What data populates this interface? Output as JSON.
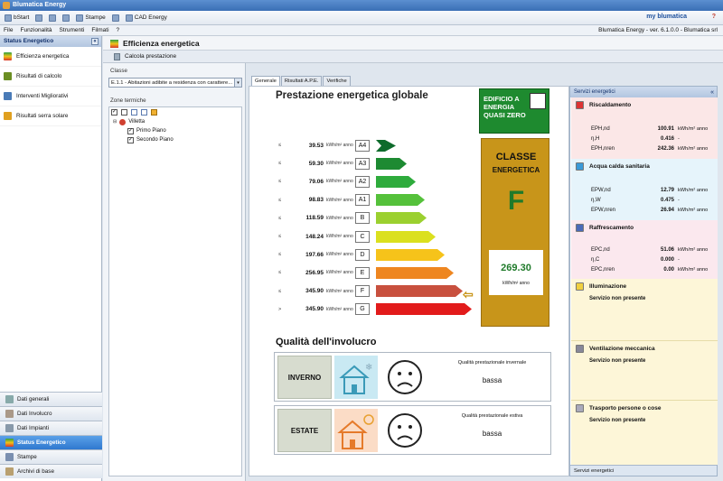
{
  "window": {
    "title": "Blumatica Energy"
  },
  "toolbar": {
    "bstart": "bStart",
    "stampe": "Stampe",
    "cad": "CAD Energy",
    "brand1": "my",
    "brand2": "blumatica"
  },
  "menu": {
    "items": [
      "File",
      "Funzionalità",
      "Strumenti",
      "Filmati",
      "?"
    ],
    "version": "Blumatica Energy - ver. 6.1.0.0 - Blumatica srl"
  },
  "left": {
    "header": "Status Energetico",
    "collapse": "«",
    "items": [
      {
        "label": "Efficienza energetica",
        "color": "#d9352b"
      },
      {
        "label": "Risultati di calcolo",
        "color": "#6b8e23"
      },
      {
        "label": "Interventi Migliorativi",
        "color": "#4a7bb7"
      },
      {
        "label": "Risultati serra solare",
        "color": "#e0a020"
      }
    ],
    "bottom": [
      {
        "label": "Dati generali"
      },
      {
        "label": "Dati Involucro"
      },
      {
        "label": "Dati Impianti"
      },
      {
        "label": "Status Energetico"
      },
      {
        "label": "Stampe"
      },
      {
        "label": "Archivi di base"
      }
    ]
  },
  "section": {
    "title": "Efficienza energetica",
    "subtitle": "Calcola prestazione"
  },
  "mid": {
    "classe_label": "Classe",
    "classe_value": "E.1.1 - Abitazioni adibite a residenza con carattere...",
    "zone_label": "Zone termiche",
    "tree_root": "Villetta",
    "tree_children": [
      "Primo Piano",
      "Secondo Piano"
    ]
  },
  "tabs": [
    "Generale",
    "Risultati A.P.E.",
    "Verifiche"
  ],
  "energy": {
    "title": "Prestazione energetica globale",
    "unit": "kWh/m² anno",
    "rows": [
      {
        "prefix": "≤",
        "value": "39.53",
        "cls": "A4",
        "color": "#0e6b2b"
      },
      {
        "prefix": "≤",
        "value": "59.30",
        "cls": "A3",
        "color": "#1d8a32"
      },
      {
        "prefix": "≤",
        "value": "79.06",
        "cls": "A2",
        "color": "#2eab3c"
      },
      {
        "prefix": "≤",
        "value": "98.83",
        "cls": "A1",
        "color": "#55c13b"
      },
      {
        "prefix": "≤",
        "value": "118.59",
        "cls": "B",
        "color": "#9bd02f"
      },
      {
        "prefix": "≤",
        "value": "148.24",
        "cls": "C",
        "color": "#dbe01f"
      },
      {
        "prefix": "≤",
        "value": "197.66",
        "cls": "D",
        "color": "#f6c31a"
      },
      {
        "prefix": "≤",
        "value": "256.95",
        "cls": "E",
        "color": "#ee8620"
      },
      {
        "prefix": "≤",
        "value": "345.90",
        "cls": "F",
        "color": "#c8503e"
      },
      {
        "prefix": ">",
        "value": "345.90",
        "cls": "G",
        "color": "#e21b1b"
      }
    ],
    "nzeb": "EDIFICIO A ENERGIA QUASI ZERO",
    "classe_title1": "CLASSE",
    "classe_title2": "ENERGETICA",
    "classe_letter": "F",
    "classe_value": "269.30",
    "classe_unit": "kWh/m² anno",
    "arrow": "⇦"
  },
  "quality": {
    "title": "Qualità dell'involucro",
    "winter": {
      "season": "INVERNO",
      "caption": "Qualità prestazionale invernale",
      "value": "bassa"
    },
    "summer": {
      "season": "ESTATE",
      "caption": "Qualità prestazionale estiva",
      "value": "bassa"
    }
  },
  "services": {
    "header": "Servizi energetici",
    "footer": "Servizi energetici",
    "heating": {
      "title": "Riscaldamento",
      "rows": [
        {
          "k": "EPH,nd",
          "v": "100.91",
          "u": "kWh/m² anno"
        },
        {
          "k": "η,H",
          "v": "0.416",
          "u": "-"
        },
        {
          "k": "EPH,nren",
          "v": "242.36",
          "u": "kWh/m² anno"
        }
      ]
    },
    "dhw": {
      "title": "Acqua calda sanitaria",
      "rows": [
        {
          "k": "EPW,nd",
          "v": "12.79",
          "u": "kWh/m² anno"
        },
        {
          "k": "η,W",
          "v": "0.475",
          "u": "-"
        },
        {
          "k": "EPW,nren",
          "v": "26.94",
          "u": "kWh/m² anno"
        }
      ]
    },
    "cooling": {
      "title": "Raffrescamento",
      "rows": [
        {
          "k": "EPC,nd",
          "v": "51.06",
          "u": "kWh/m² anno"
        },
        {
          "k": "η,C",
          "v": "0.000",
          "u": "-"
        },
        {
          "k": "EPC,nren",
          "v": "0.00",
          "u": "kWh/m² anno"
        }
      ]
    },
    "lighting": {
      "title": "Illuminazione",
      "np": "Servizio non presente"
    },
    "ventilation": {
      "title": "Ventilazione meccanica",
      "np": "Servizio non presente"
    },
    "transport": {
      "title": "Trasporto persone o cose",
      "np": "Servizio non presente"
    }
  }
}
